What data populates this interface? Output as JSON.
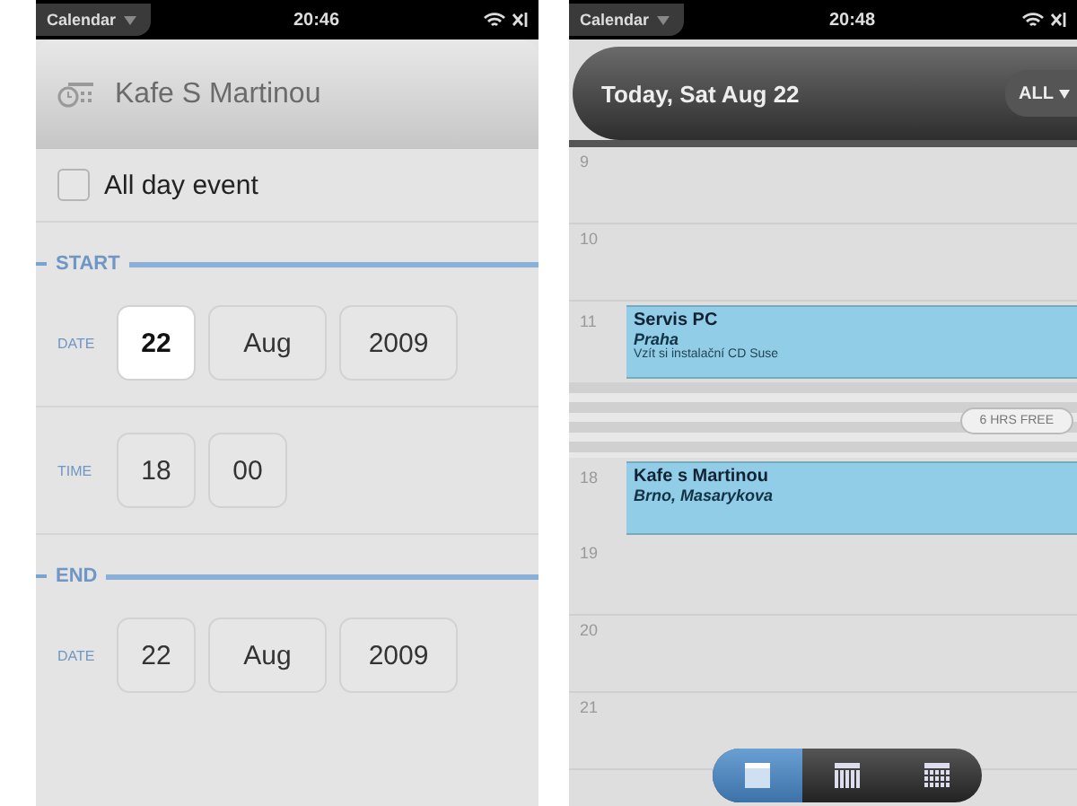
{
  "edit_screen": {
    "status_bar": {
      "app": "Calendar",
      "time": "20:46"
    },
    "title": "Kafe S Martinou",
    "all_day": {
      "label": "All day event",
      "checked": false
    },
    "sections": [
      {
        "label": "START",
        "rows": [
          {
            "label": "DATE",
            "fields": [
              {
                "value": "22",
                "selected": true
              },
              {
                "value": "Aug",
                "selected": false
              },
              {
                "value": "2009",
                "selected": false
              }
            ]
          },
          {
            "label": "TIME",
            "fields": [
              {
                "value": "18",
                "selected": false
              },
              {
                "value": "00",
                "selected": false
              }
            ]
          }
        ]
      },
      {
        "label": "END",
        "rows": [
          {
            "label": "DATE",
            "fields": [
              {
                "value": "22",
                "selected": false
              },
              {
                "value": "Aug",
                "selected": false
              },
              {
                "value": "2009",
                "selected": false
              }
            ]
          }
        ]
      }
    ]
  },
  "day_screen": {
    "status_bar": {
      "app": "Calendar",
      "time": "20:48"
    },
    "header": {
      "title": "Today, Sat Aug 22",
      "filter": "ALL"
    },
    "timeline": [
      {
        "kind": "hour",
        "hour": "9"
      },
      {
        "kind": "hour",
        "hour": "10"
      },
      {
        "kind": "event",
        "hour": "11",
        "title": "Servis PC",
        "location": "Praha",
        "note": "Vzít si instalační CD Suse"
      },
      {
        "kind": "free",
        "label": "6 HRS FREE"
      },
      {
        "kind": "event",
        "hour": "18",
        "title": "Kafe s Martinou",
        "location": "Brno, Masarykova"
      },
      {
        "kind": "hour",
        "hour": "19"
      },
      {
        "kind": "hour",
        "hour": "20"
      },
      {
        "kind": "hour",
        "hour": "21"
      }
    ],
    "view_switcher": [
      {
        "kind": "day",
        "selected": true
      },
      {
        "kind": "week",
        "selected": false
      },
      {
        "kind": "month",
        "selected": false
      }
    ]
  }
}
